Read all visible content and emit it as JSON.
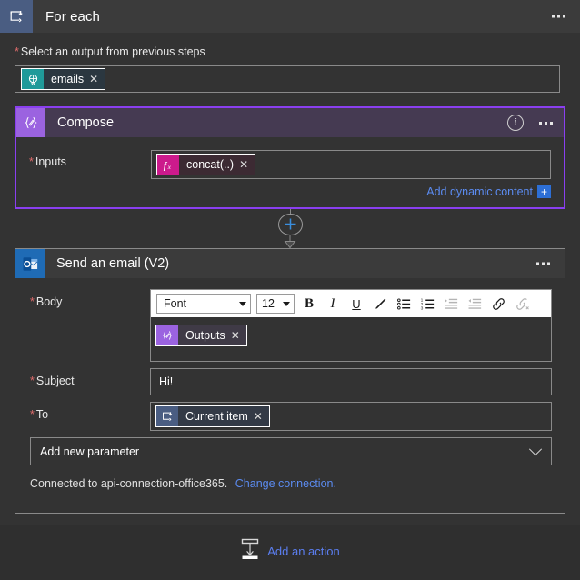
{
  "foreach": {
    "title": "For each",
    "icon": "foreach-loop-icon",
    "menu_icon": "ellipsis-icon",
    "select_output": {
      "label": "Select an output from previous steps",
      "required": true,
      "token": {
        "text": "emails",
        "icon": "dynamic-content-icon",
        "remove": "✕"
      }
    }
  },
  "compose": {
    "title": "Compose",
    "icon": "compose-braces-icon",
    "info_icon": "i",
    "menu_icon": "ellipsis-icon",
    "inputs": {
      "label": "Inputs",
      "required": true,
      "token": {
        "text": "concat(..)",
        "icon": "fx",
        "remove": "✕"
      }
    },
    "add_dynamic_content": {
      "label": "Add dynamic content",
      "plus": "+"
    },
    "accent_color": "#8a3ff0"
  },
  "connector": {
    "icon": "add-step-plus-icon",
    "plus_color": "#3a8ede"
  },
  "email": {
    "title": "Send an email (V2)",
    "icon": "outlook-icon",
    "menu_icon": "ellipsis-icon",
    "body": {
      "label": "Body",
      "required": true,
      "toolbar": {
        "font_name": "Font",
        "font_size": "12",
        "buttons": [
          {
            "name": "bold-button",
            "glyph": "B",
            "disabled": false
          },
          {
            "name": "italic-button",
            "glyph": "I",
            "disabled": false
          },
          {
            "name": "underline-button",
            "glyph": "U",
            "disabled": false
          },
          {
            "name": "text-color-button",
            "glyph": "pen",
            "disabled": false
          },
          {
            "name": "bulleted-list-button",
            "glyph": "ul",
            "disabled": false
          },
          {
            "name": "numbered-list-button",
            "glyph": "ol",
            "disabled": false
          },
          {
            "name": "indent-increase-button",
            "glyph": "indent",
            "disabled": true
          },
          {
            "name": "indent-decrease-button",
            "glyph": "outdent",
            "disabled": true
          },
          {
            "name": "insert-link-button",
            "glyph": "link",
            "disabled": false
          },
          {
            "name": "remove-link-button",
            "glyph": "unlink",
            "disabled": true
          }
        ]
      },
      "token": {
        "text": "Outputs",
        "icon": "compose-braces-icon",
        "remove": "✕"
      }
    },
    "subject": {
      "label": "Subject",
      "required": true,
      "value": "Hi!"
    },
    "to": {
      "label": "To",
      "required": true,
      "token": {
        "text": "Current item",
        "icon": "foreach-loop-icon",
        "remove": "✕"
      }
    },
    "add_new_parameter": {
      "label": "Add new parameter",
      "chevron": "chevron-down-icon"
    },
    "connection": {
      "text": "Connected to api-connection-office365.",
      "change_link": "Change connection."
    }
  },
  "add_action": {
    "label": "Add an action",
    "icon": "add-action-icon"
  }
}
